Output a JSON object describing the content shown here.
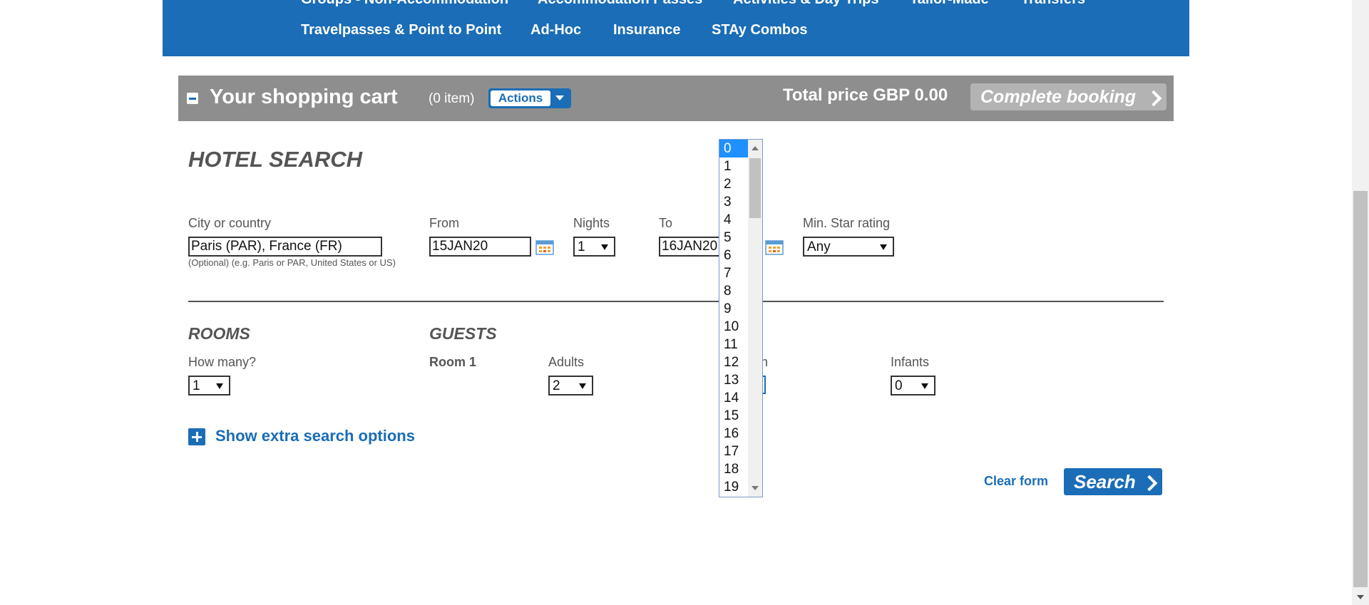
{
  "nav": {
    "row1": [
      "Groups - Non-Accommodation",
      "Accommodation Passes",
      "Activities & Day Trips",
      "Tailor-Made",
      "Transfers"
    ],
    "row2": [
      "Travelpasses & Point to Point",
      "Ad-Hoc",
      "Insurance",
      "STAy Combos"
    ]
  },
  "cart": {
    "title": "Your shopping cart",
    "count": "(0 item)",
    "actions_label": "Actions",
    "total_label": "Total price GBP 0.00",
    "complete_label": "Complete booking"
  },
  "search": {
    "title": "HOTEL SEARCH",
    "city_label": "City or country",
    "city_value": "Paris (PAR), France (FR)",
    "city_hint": "(Optional) (e.g. Paris or PAR, United States or US)",
    "from_label": "From",
    "from_value": "15JAN20",
    "nights_label": "Nights",
    "nights_value": "1",
    "to_label": "To",
    "to_value": "16JAN20",
    "star_label": "Min. Star rating",
    "star_value": "Any"
  },
  "rooms": {
    "title": "ROOMS",
    "how_many_label": "How many?",
    "how_many_value": "1"
  },
  "guests": {
    "title": "GUESTS",
    "room_label": "Room 1",
    "adults_label": "Adults",
    "adults_value": "2",
    "children_label_partial": "n",
    "infants_label": "Infants",
    "infants_value": "0"
  },
  "extra_options_label": "Show extra search options",
  "clear_label": "Clear form",
  "search_label": "Search",
  "dropdown": {
    "selected": "0",
    "options": [
      "0",
      "1",
      "2",
      "3",
      "4",
      "5",
      "6",
      "7",
      "8",
      "9",
      "10",
      "11",
      "12",
      "13",
      "14",
      "15",
      "16",
      "17",
      "18",
      "19"
    ]
  },
  "colors": {
    "brand_blue": "#1a6db6",
    "cart_gray": "#8e8e8e",
    "dropdown_selected": "#1e90ff"
  }
}
